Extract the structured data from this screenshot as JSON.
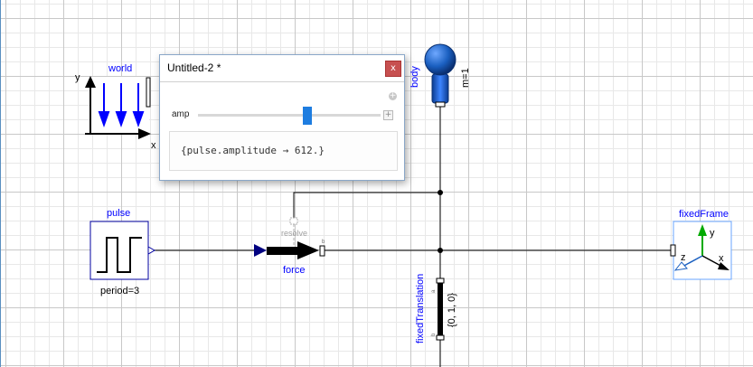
{
  "diagram": {
    "world": {
      "label": "world",
      "axis_y": "y",
      "axis_x": "x"
    },
    "body": {
      "label": "body",
      "param": "m=1"
    },
    "pulse": {
      "label": "pulse",
      "param": "period=3"
    },
    "force": {
      "label": "force",
      "connector_hint": "resolve",
      "port_a": "a",
      "port_b": "b"
    },
    "fixedTranslation": {
      "label": "fixedTranslation",
      "param": "{0, 1, 0}",
      "port_a": "a",
      "port_b": "b"
    },
    "fixedFrame": {
      "label": "fixedFrame",
      "axis_y": "y",
      "axis_z": "z",
      "axis_x": "x"
    }
  },
  "popup": {
    "title": "Untitled-2 *",
    "close_label": "x",
    "control_label": "amp",
    "add_icon": "plus-circle-icon",
    "expand_icon": "plus-box-icon",
    "slider_fraction": 0.6,
    "output_text": "{pulse.amplitude → 612.}"
  },
  "colors": {
    "label_blue": "#0000ff",
    "close_red": "#c75050",
    "slider_blue": "#1e7de0",
    "body_blue": "#1a5fc0",
    "frame_green": "#00aa00"
  }
}
